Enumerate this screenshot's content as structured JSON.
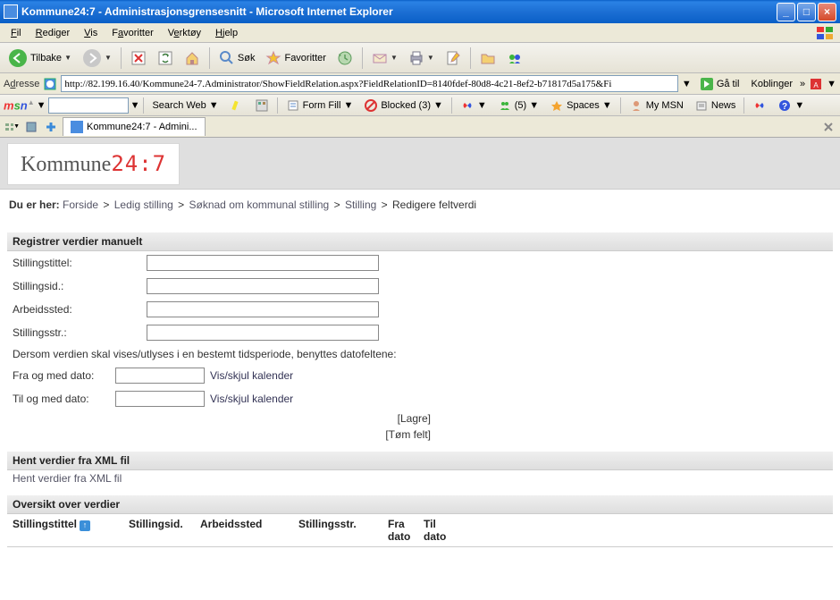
{
  "window": {
    "title": "Kommune24:7 - Administrasjonsgrensesnitt - Microsoft Internet Explorer"
  },
  "menubar": {
    "fil": "Fil",
    "rediger": "Rediger",
    "vis": "Vis",
    "favoritter": "Favoritter",
    "verktoy": "Verktøy",
    "hjelp": "Hjelp"
  },
  "toolbar": {
    "tilbake": "Tilbake",
    "sok": "Søk",
    "favoritter": "Favoritter"
  },
  "addrbar": {
    "label": "Adresse",
    "url": "http://82.199.16.40/Kommune24-7.Administrator/ShowFieldRelation.aspx?FieldRelationID=8140fdef-80d8-4c21-8ef2-b71817d5a175&Fi",
    "goto": "Gå til",
    "links": "Koblinger"
  },
  "msnbar": {
    "searchweb": "Search Web",
    "formfill": "Form Fill",
    "blocked": "Blocked (3)",
    "spaces": "Spaces",
    "people_count": "(5)",
    "mymsn": "My MSN",
    "news": "News"
  },
  "tabbar": {
    "tab1": "Kommune24:7 - Admini..."
  },
  "brand": {
    "name_a": "Kommune",
    "name_b": "24:7"
  },
  "breadcrumb": {
    "prefix": "Du er her:",
    "items": [
      "Forside",
      "Ledig stilling",
      "Søknad om kommunal stilling",
      "Stilling",
      "Redigere feltverdi"
    ]
  },
  "section1": {
    "title": "Registrer verdier manuelt",
    "stillingstittel": "Stillingstittel:",
    "stillingsid": "Stillingsid.:",
    "arbeidssted": "Arbeidssted:",
    "stillingsstr": "Stillingsstr.:",
    "note": "Dersom verdien skal vises/utlyses i en bestemt tidsperiode, benyttes datofeltene:",
    "fra_dato": "Fra og med dato:",
    "til_dato": "Til og med dato:",
    "vis_skjul": "Vis/skjul kalender",
    "lagre": "[Lagre]",
    "tom_felt": "[Tøm felt]"
  },
  "section2": {
    "title": "Hent verdier fra XML fil",
    "link": "Hent verdier fra XML fil"
  },
  "section3": {
    "title": "Oversikt over verdier",
    "cols": {
      "stillingstittel": "Stillingstittel",
      "stillingsid": "Stillingsid.",
      "arbeidssted": "Arbeidssted",
      "stillingsstr": "Stillingsstr.",
      "fra_dato": "Fra dato",
      "til_dato": "Til dato"
    }
  }
}
